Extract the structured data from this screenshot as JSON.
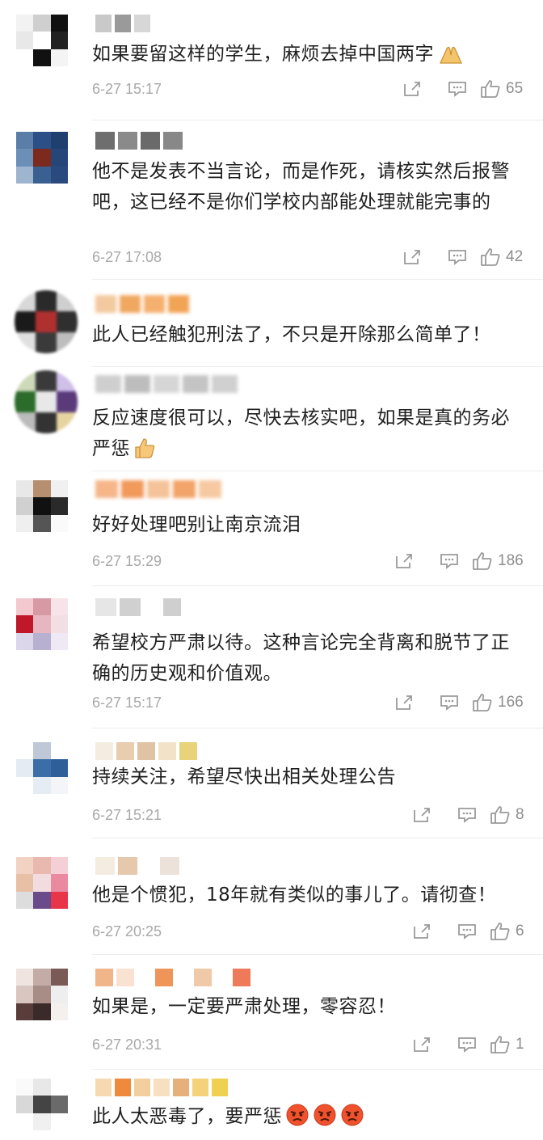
{
  "comments": [
    {
      "text": "如果要留这样的学生，麻烦去掉中国两字",
      "time": "6-27 15:17",
      "likes": "65",
      "emoji": "pray-hands"
    },
    {
      "text": "他不是发表不当言论，而是作死，请核实然后报警吧，这已经不是你们学校内部能处理就能完事的",
      "time": "6-27 17:08",
      "likes": "42"
    },
    {
      "text": "此人已经触犯刑法了，不只是开除那么简单了！"
    },
    {
      "text": "反应速度很可以，尽快去核实吧，如果是真的务必严惩",
      "emoji": "thumbs-up"
    },
    {
      "text": "好好处理吧别让南京流泪",
      "time": "6-27 15:29",
      "likes": "186"
    },
    {
      "text": "希望校方严肃以待。这种言论完全背离和脱节了正确的历史观和价值观。",
      "time": "6-27 15:17",
      "likes": "166"
    },
    {
      "text": "持续关注，希望尽快出相关处理公告",
      "time": "6-27 15:21",
      "likes": "8"
    },
    {
      "text": "他是个惯犯，18年就有类似的事儿了。请彻查！",
      "time": "6-27 20:25",
      "likes": "6"
    },
    {
      "text": "如果是，一定要严肃处理，零容忍！",
      "time": "6-27 20:31",
      "likes": "1"
    },
    {
      "text": "此人太恶毒了，要严惩",
      "emoji": "angry-face"
    }
  ],
  "icons": {
    "share": "share-icon",
    "reply": "comment-icon",
    "like": "thumbs-up-icon"
  },
  "colors": {
    "text": "#1f1f1f",
    "meta": "#a8a8a8",
    "icon": "#9a9a9a",
    "divider": "#ececec"
  }
}
